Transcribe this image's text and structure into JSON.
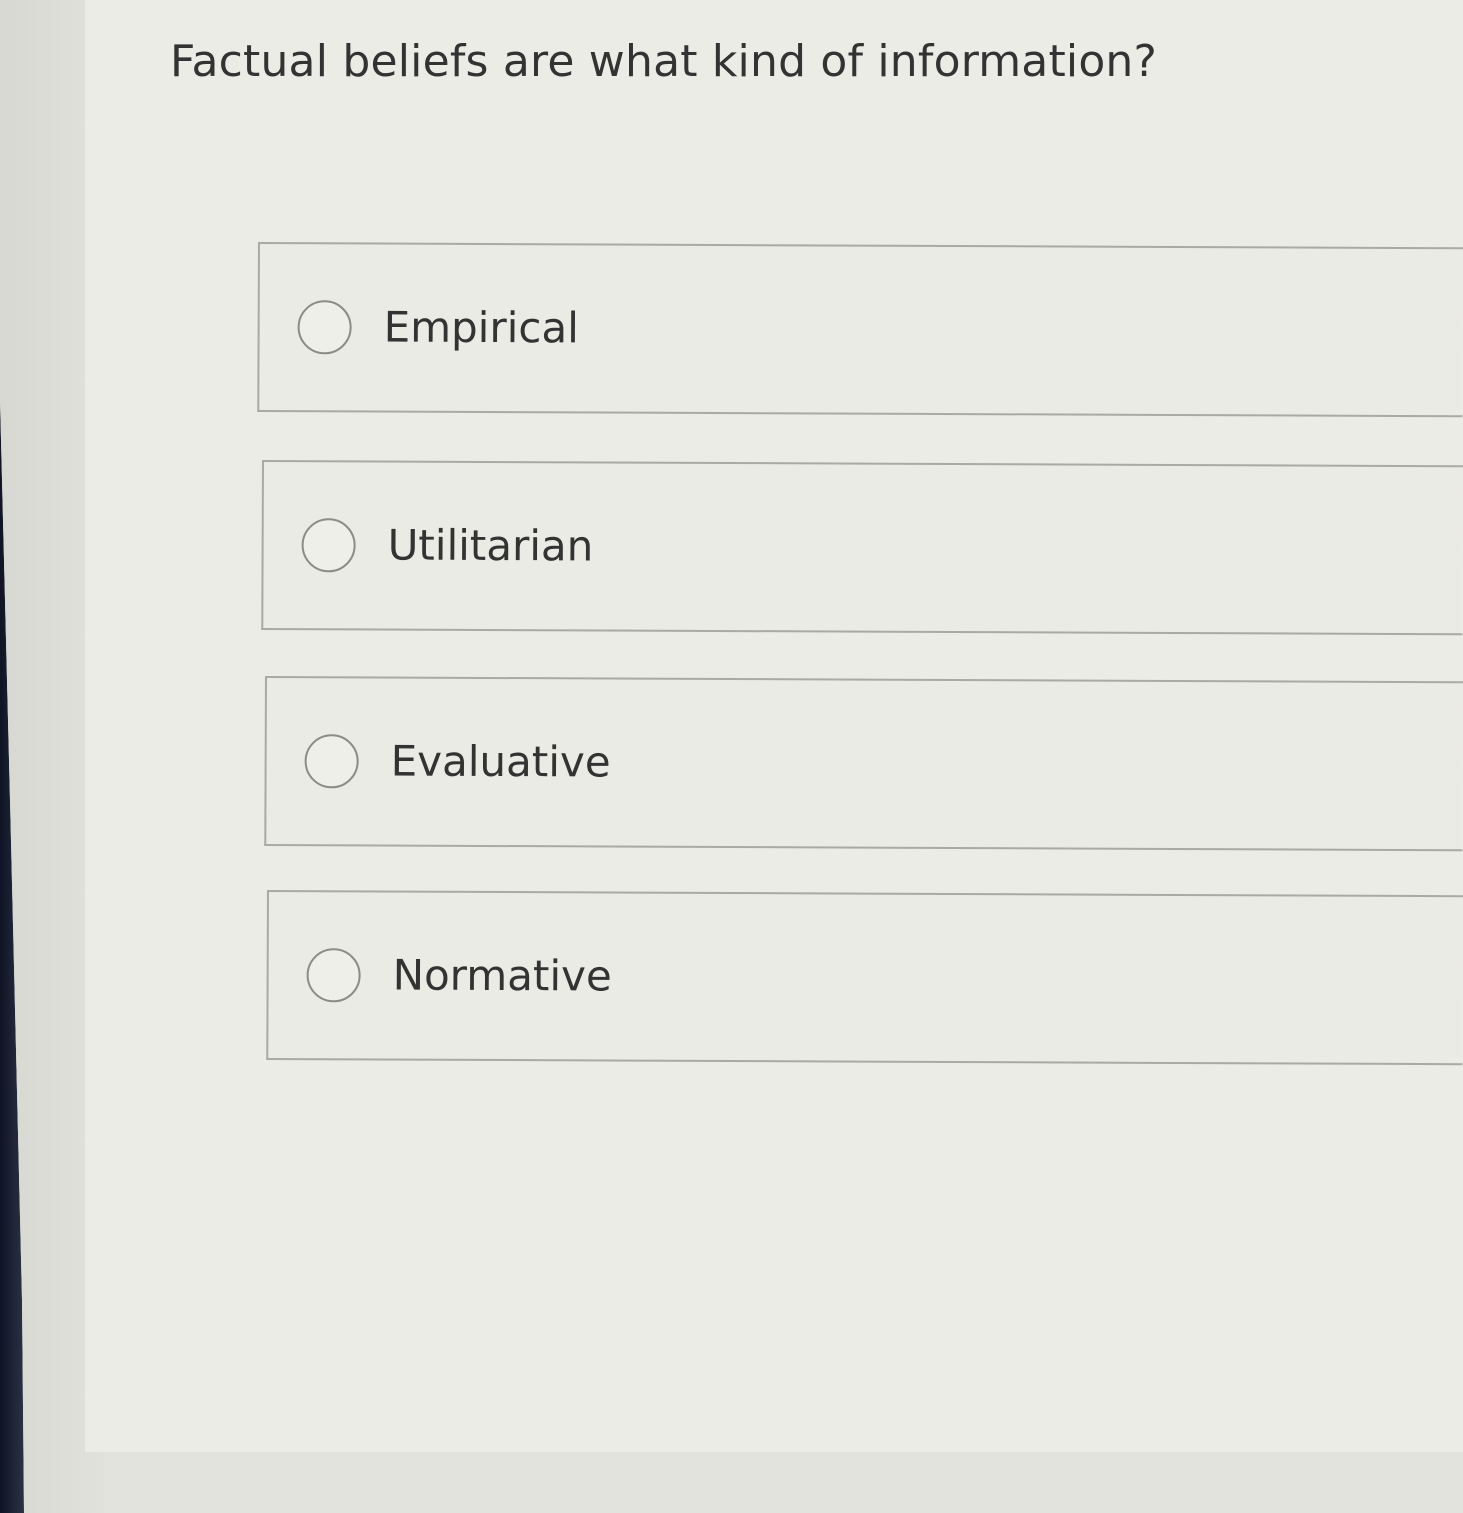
{
  "question": {
    "text": "Factual beliefs are what kind of information?"
  },
  "choices": [
    {
      "label": "Empirical",
      "selected": false
    },
    {
      "label": "Utilitarian",
      "selected": false
    },
    {
      "label": "Evaluative",
      "selected": false
    },
    {
      "label": "Normative",
      "selected": false
    }
  ]
}
